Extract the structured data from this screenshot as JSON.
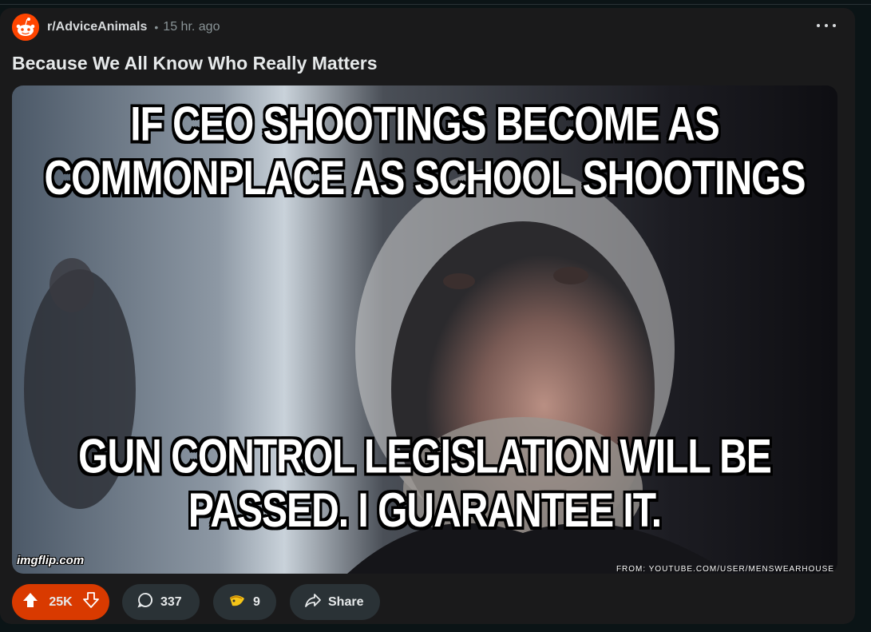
{
  "post": {
    "subreddit": "r/AdviceAnimals",
    "separator": "•",
    "time": "15 hr. ago",
    "title": "Because We All Know Who Really Matters"
  },
  "meme": {
    "top_text": "IF CEO SHOOTINGS BECOME AS COMMONPLACE AS SCHOOL SHOOTINGS",
    "bottom_text": "GUN CONTROL LEGISLATION WILL BE PASSED. I GUARANTEE IT.",
    "watermark_left": "imgflip.com",
    "watermark_right": "FROM: YOUTUBE.COM/USER/MENSWEARHOUSE"
  },
  "actions": {
    "upvotes": "25K",
    "comments": "337",
    "awards": "9",
    "share_label": "Share"
  },
  "colors": {
    "background": "#0b1416",
    "card": "#1a1a1b",
    "upvote_accent": "#d93a00",
    "button": "#2a3236"
  },
  "icons": [
    "reddit-avatar-icon",
    "more-options-icon",
    "upvote-arrow-icon",
    "downvote-arrow-icon",
    "comment-bubble-icon",
    "award-icon",
    "share-arrow-icon"
  ]
}
